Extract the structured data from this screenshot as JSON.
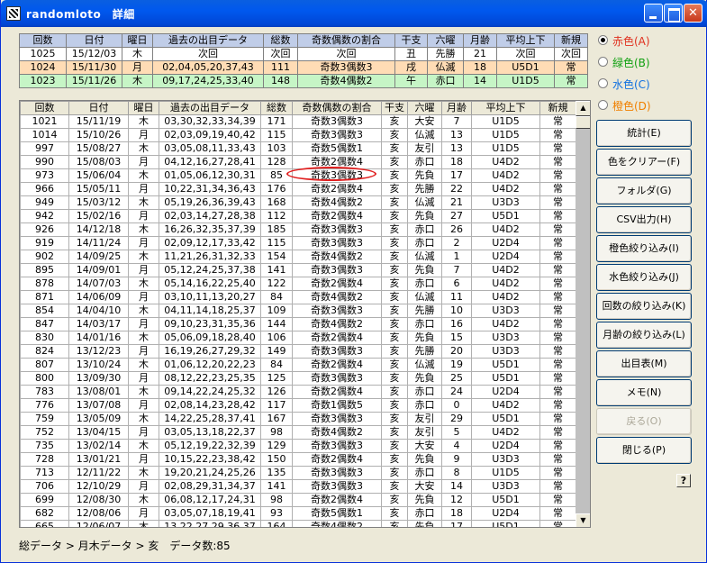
{
  "window": {
    "title": "randomloto　詳細",
    "close_glyph": "✕"
  },
  "top_table": {
    "headers": [
      "回数",
      "日付",
      "曜日",
      "過去の出目データ",
      "総数",
      "奇数偶数の割合",
      "干支",
      "六曜",
      "月齢",
      "平均上下",
      "新規"
    ],
    "rows": [
      [
        "1025",
        "15/12/03",
        "木",
        "次回",
        "次回",
        "次回",
        "丑",
        "先勝",
        "21",
        "次回",
        "次回"
      ],
      [
        "1024",
        "15/11/30",
        "月",
        "02,04,05,20,37,43",
        "111",
        "奇数3偶数3",
        "戌",
        "仏滅",
        "18",
        "U5D1",
        "常"
      ],
      [
        "1023",
        "15/11/26",
        "木",
        "09,17,24,25,33,40",
        "148",
        "奇数4偶数2",
        "午",
        "赤口",
        "14",
        "U1D5",
        "常"
      ]
    ]
  },
  "main_table": {
    "headers": [
      "回数",
      "日付",
      "曜日",
      "過去の出目データ",
      "総数",
      "奇数偶数の割合",
      "干支",
      "六曜",
      "月齢",
      "平均上下",
      "新規"
    ],
    "rows": [
      [
        "1021",
        "15/11/19",
        "木",
        "03,30,32,33,34,39",
        "171",
        "奇数3偶数3",
        "亥",
        "大安",
        "7",
        "U1D5",
        "常"
      ],
      [
        "1014",
        "15/10/26",
        "月",
        "02,03,09,19,40,42",
        "115",
        "奇数3偶数3",
        "亥",
        "仏滅",
        "13",
        "U1D5",
        "常"
      ],
      [
        "997",
        "15/08/27",
        "木",
        "03,05,08,11,33,43",
        "103",
        "奇数5偶数1",
        "亥",
        "友引",
        "13",
        "U1D5",
        "常"
      ],
      [
        "990",
        "15/08/03",
        "月",
        "04,12,16,27,28,41",
        "128",
        "奇数2偶数4",
        "亥",
        "赤口",
        "18",
        "U4D2",
        "常"
      ],
      [
        "973",
        "15/06/04",
        "木",
        "01,05,06,12,30,31",
        "85",
        "奇数3偶数3",
        "亥",
        "先負",
        "17",
        "U4D2",
        "常"
      ],
      [
        "966",
        "15/05/11",
        "月",
        "10,22,31,34,36,43",
        "176",
        "奇数2偶数4",
        "亥",
        "先勝",
        "22",
        "U4D2",
        "常"
      ],
      [
        "949",
        "15/03/12",
        "木",
        "05,19,26,36,39,43",
        "168",
        "奇数4偶数2",
        "亥",
        "仏滅",
        "21",
        "U3D3",
        "常"
      ],
      [
        "942",
        "15/02/16",
        "月",
        "02,03,14,27,28,38",
        "112",
        "奇数2偶数4",
        "亥",
        "先負",
        "27",
        "U5D1",
        "常"
      ],
      [
        "926",
        "14/12/18",
        "木",
        "16,26,32,35,37,39",
        "185",
        "奇数3偶数3",
        "亥",
        "赤口",
        "26",
        "U4D2",
        "常"
      ],
      [
        "919",
        "14/11/24",
        "月",
        "02,09,12,17,33,42",
        "115",
        "奇数3偶数3",
        "亥",
        "赤口",
        "2",
        "U2D4",
        "常"
      ],
      [
        "902",
        "14/09/25",
        "木",
        "11,21,26,31,32,33",
        "154",
        "奇数4偶数2",
        "亥",
        "仏滅",
        "1",
        "U2D4",
        "常"
      ],
      [
        "895",
        "14/09/01",
        "月",
        "05,12,24,25,37,38",
        "141",
        "奇数3偶数3",
        "亥",
        "先負",
        "7",
        "U4D2",
        "常"
      ],
      [
        "878",
        "14/07/03",
        "木",
        "05,14,16,22,25,40",
        "122",
        "奇数2偶数4",
        "亥",
        "赤口",
        "6",
        "U4D2",
        "常"
      ],
      [
        "871",
        "14/06/09",
        "月",
        "03,10,11,13,20,27",
        "84",
        "奇数4偶数2",
        "亥",
        "仏滅",
        "11",
        "U4D2",
        "常"
      ],
      [
        "854",
        "14/04/10",
        "木",
        "04,11,14,18,25,37",
        "109",
        "奇数3偶数3",
        "亥",
        "先勝",
        "10",
        "U3D3",
        "常"
      ],
      [
        "847",
        "14/03/17",
        "月",
        "09,10,23,31,35,36",
        "144",
        "奇数4偶数2",
        "亥",
        "赤口",
        "16",
        "U4D2",
        "常"
      ],
      [
        "830",
        "14/01/16",
        "木",
        "05,06,09,18,28,40",
        "106",
        "奇数2偶数4",
        "亥",
        "先負",
        "15",
        "U3D3",
        "常"
      ],
      [
        "824",
        "13/12/23",
        "月",
        "16,19,26,27,29,32",
        "149",
        "奇数3偶数3",
        "亥",
        "先勝",
        "20",
        "U3D3",
        "常"
      ],
      [
        "807",
        "13/10/24",
        "木",
        "01,06,12,20,22,23",
        "84",
        "奇数2偶数4",
        "亥",
        "仏滅",
        "19",
        "U5D1",
        "常"
      ],
      [
        "800",
        "13/09/30",
        "月",
        "08,12,22,23,25,35",
        "125",
        "奇数3偶数3",
        "亥",
        "先負",
        "25",
        "U5D1",
        "常"
      ],
      [
        "783",
        "13/08/01",
        "木",
        "09,14,22,24,25,32",
        "126",
        "奇数2偶数4",
        "亥",
        "赤口",
        "24",
        "U2D4",
        "常"
      ],
      [
        "776",
        "13/07/08",
        "月",
        "02,08,14,23,28,42",
        "117",
        "奇数1偶数5",
        "亥",
        "赤口",
        "0",
        "U4D2",
        "常"
      ],
      [
        "759",
        "13/05/09",
        "木",
        "14,22,25,28,37,41",
        "167",
        "奇数3偶数3",
        "亥",
        "友引",
        "29",
        "U5D1",
        "常"
      ],
      [
        "752",
        "13/04/15",
        "月",
        "03,05,13,18,22,37",
        "98",
        "奇数4偶数2",
        "亥",
        "友引",
        "5",
        "U4D2",
        "常"
      ],
      [
        "735",
        "13/02/14",
        "木",
        "05,12,19,22,32,39",
        "129",
        "奇数3偶数3",
        "亥",
        "大安",
        "4",
        "U2D4",
        "常"
      ],
      [
        "728",
        "13/01/21",
        "月",
        "10,15,22,23,38,42",
        "150",
        "奇数2偶数4",
        "亥",
        "先負",
        "9",
        "U3D3",
        "常"
      ],
      [
        "713",
        "12/11/22",
        "木",
        "19,20,21,24,25,26",
        "135",
        "奇数3偶数3",
        "亥",
        "赤口",
        "8",
        "U1D5",
        "常"
      ],
      [
        "706",
        "12/10/29",
        "月",
        "02,08,29,31,34,37",
        "141",
        "奇数3偶数3",
        "亥",
        "大安",
        "14",
        "U3D3",
        "常"
      ],
      [
        "699",
        "12/08/30",
        "木",
        "06,08,12,17,24,31",
        "98",
        "奇数2偶数4",
        "亥",
        "先負",
        "12",
        "U5D1",
        "常"
      ],
      [
        "682",
        "12/08/06",
        "月",
        "03,05,07,18,19,41",
        "93",
        "奇数5偶数1",
        "亥",
        "赤口",
        "18",
        "U2D4",
        "常"
      ],
      [
        "665",
        "12/06/07",
        "木",
        "13,22,27,29,36,37",
        "164",
        "奇数4偶数2",
        "亥",
        "先負",
        "17",
        "U5D1",
        "常"
      ]
    ]
  },
  "status_text": "総データ > 月木データ > 亥　データ数:85",
  "radios": [
    {
      "label": "赤色(A)",
      "color": "#e0301e",
      "checked": true
    },
    {
      "label": "緑色(B)",
      "color": "#10a010",
      "checked": false
    },
    {
      "label": "水色(C)",
      "color": "#1070e0",
      "checked": false
    },
    {
      "label": "橙色(D)",
      "color": "#f08000",
      "checked": false
    }
  ],
  "buttons": [
    {
      "label": "統計(E)",
      "enabled": true
    },
    {
      "label": "色をクリアー(F)",
      "enabled": true
    },
    {
      "label": "フォルダ(G)",
      "enabled": true
    },
    {
      "label": "CSV出力(H)",
      "enabled": true
    },
    {
      "label": "橙色絞り込み(I)",
      "enabled": true
    },
    {
      "label": "水色絞り込み(J)",
      "enabled": true
    },
    {
      "label": "回数の絞り込み(K)",
      "enabled": true
    },
    {
      "label": "月齢の絞り込み(L)",
      "enabled": true
    },
    {
      "label": "出目表(M)",
      "enabled": true
    },
    {
      "label": "メモ(N)",
      "enabled": true
    },
    {
      "label": "戻る(O)",
      "enabled": false
    },
    {
      "label": "閉じる(P)",
      "enabled": true
    }
  ],
  "help_label": "?"
}
